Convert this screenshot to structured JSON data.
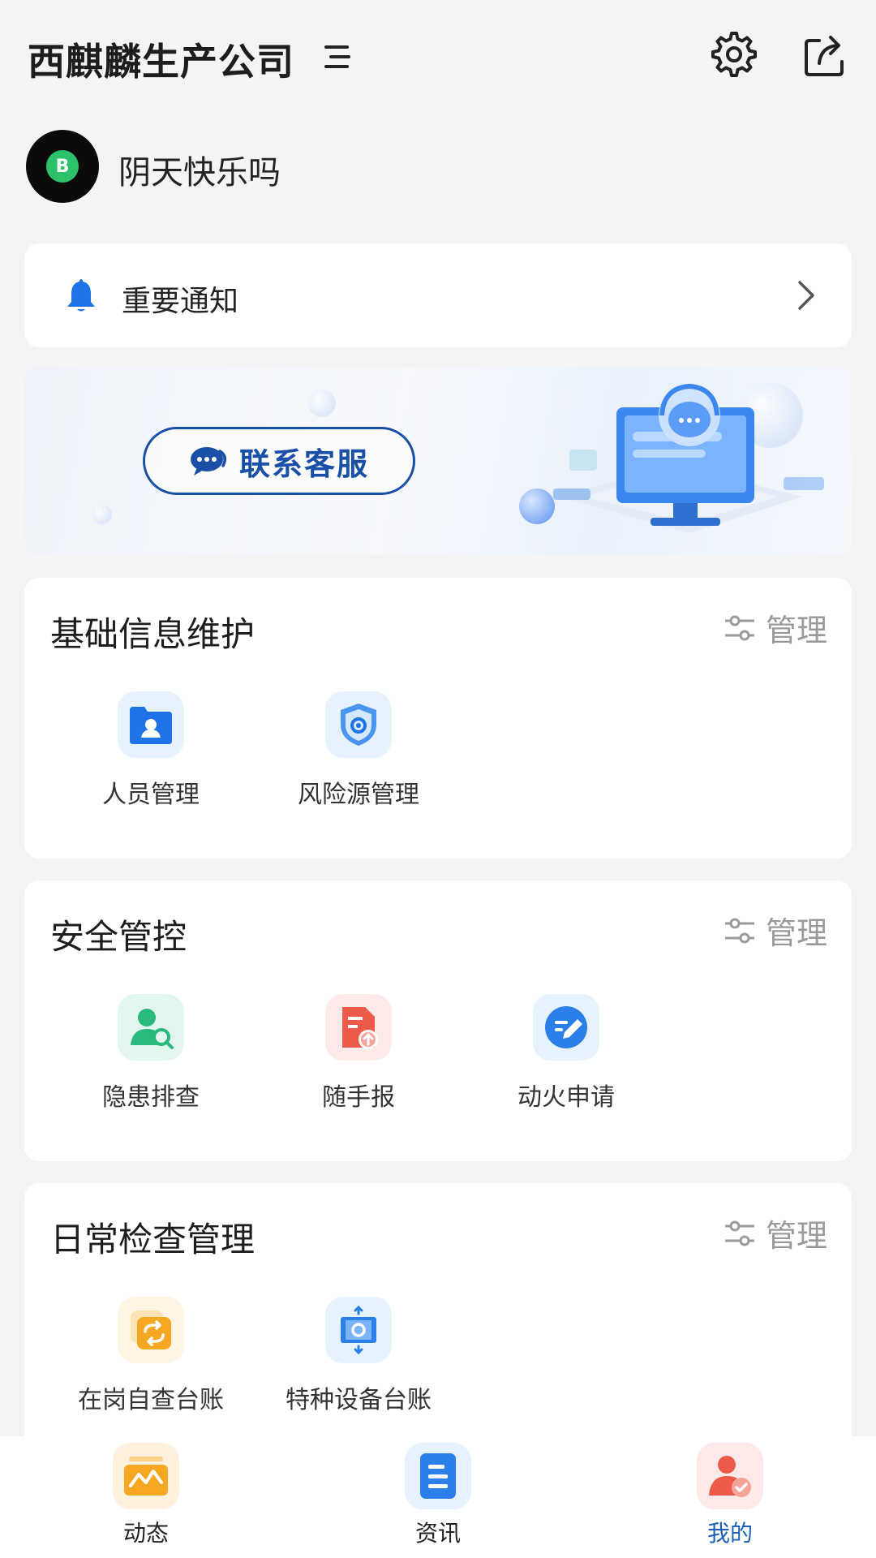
{
  "header": {
    "company_name": "西麒麟生产公司"
  },
  "user": {
    "name": "阴天快乐吗",
    "avatar_glyph": "B"
  },
  "notice": {
    "label": "重要通知"
  },
  "banner": {
    "contact_label": "联系客服"
  },
  "sections": [
    {
      "title": "基础信息维护",
      "manage_label": "管理",
      "items": [
        {
          "label": "人员管理",
          "icon": "person-folder-icon"
        },
        {
          "label": "风险源管理",
          "icon": "shield-gear-icon"
        }
      ]
    },
    {
      "title": "安全管控",
      "manage_label": "管理",
      "items": [
        {
          "label": "隐患排查",
          "icon": "person-search-icon"
        },
        {
          "label": "随手报",
          "icon": "report-upload-icon"
        },
        {
          "label": "动火申请",
          "icon": "edit-pen-icon"
        }
      ]
    },
    {
      "title": "日常检查管理",
      "manage_label": "管理",
      "items": [
        {
          "label": "在岗自查台账",
          "icon": "refresh-ledger-icon"
        },
        {
          "label": "特种设备台账",
          "icon": "equipment-gear-icon"
        }
      ]
    }
  ],
  "bottom_nav": [
    {
      "label": "动态",
      "icon": "activity-icon",
      "active": false
    },
    {
      "label": "资讯",
      "icon": "news-icon",
      "active": false
    },
    {
      "label": "我的",
      "icon": "profile-icon",
      "active": true
    }
  ],
  "colors": {
    "accent_blue": "#1a4fa8",
    "active_nav": "#1d5fb8",
    "background": "#f4f4f5"
  }
}
